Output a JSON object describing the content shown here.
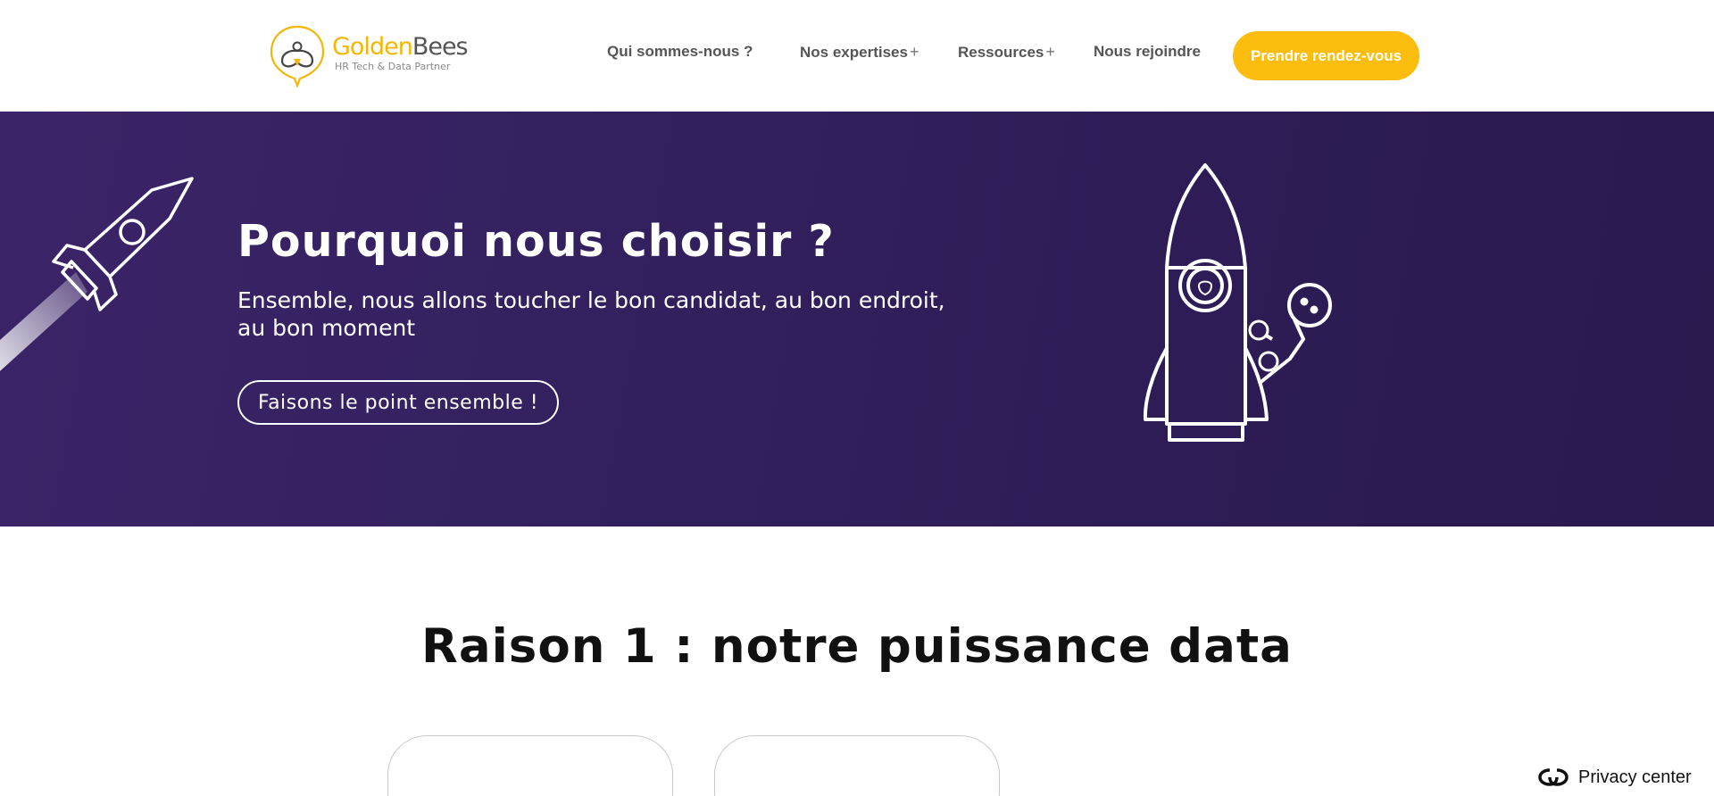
{
  "header": {
    "logo": {
      "name_part1": "Golden",
      "name_part2": "Bees",
      "tagline": "HR Tech & Data Partner"
    },
    "nav": [
      {
        "label": "Qui sommes-nous ?",
        "has_submenu": false
      },
      {
        "label": "Nos expertises",
        "has_submenu": true
      },
      {
        "label": "Ressources",
        "has_submenu": true
      },
      {
        "label": "Nous rejoindre",
        "has_submenu": false
      }
    ],
    "submenu_symbol": "+",
    "cta_label": "Prendre rendez-vous"
  },
  "hero": {
    "title": "Pourquoi nous choisir ?",
    "subtitle": "Ensemble, nous allons toucher le bon candidat, au bon endroit, au bon moment",
    "button_label": "Faisons le point ensemble !"
  },
  "section": {
    "title": "Raison 1 : notre puissance data"
  },
  "privacy": {
    "label": "Privacy center"
  },
  "colors": {
    "brand_yellow": "#fdbd0f",
    "hero_purple": "#33215f",
    "text_dark": "#111111",
    "nav_text": "#555555"
  },
  "icons": [
    "bee-logo-icon",
    "rocket-left-icon",
    "rocket-right-icon",
    "privacy-icon"
  ]
}
